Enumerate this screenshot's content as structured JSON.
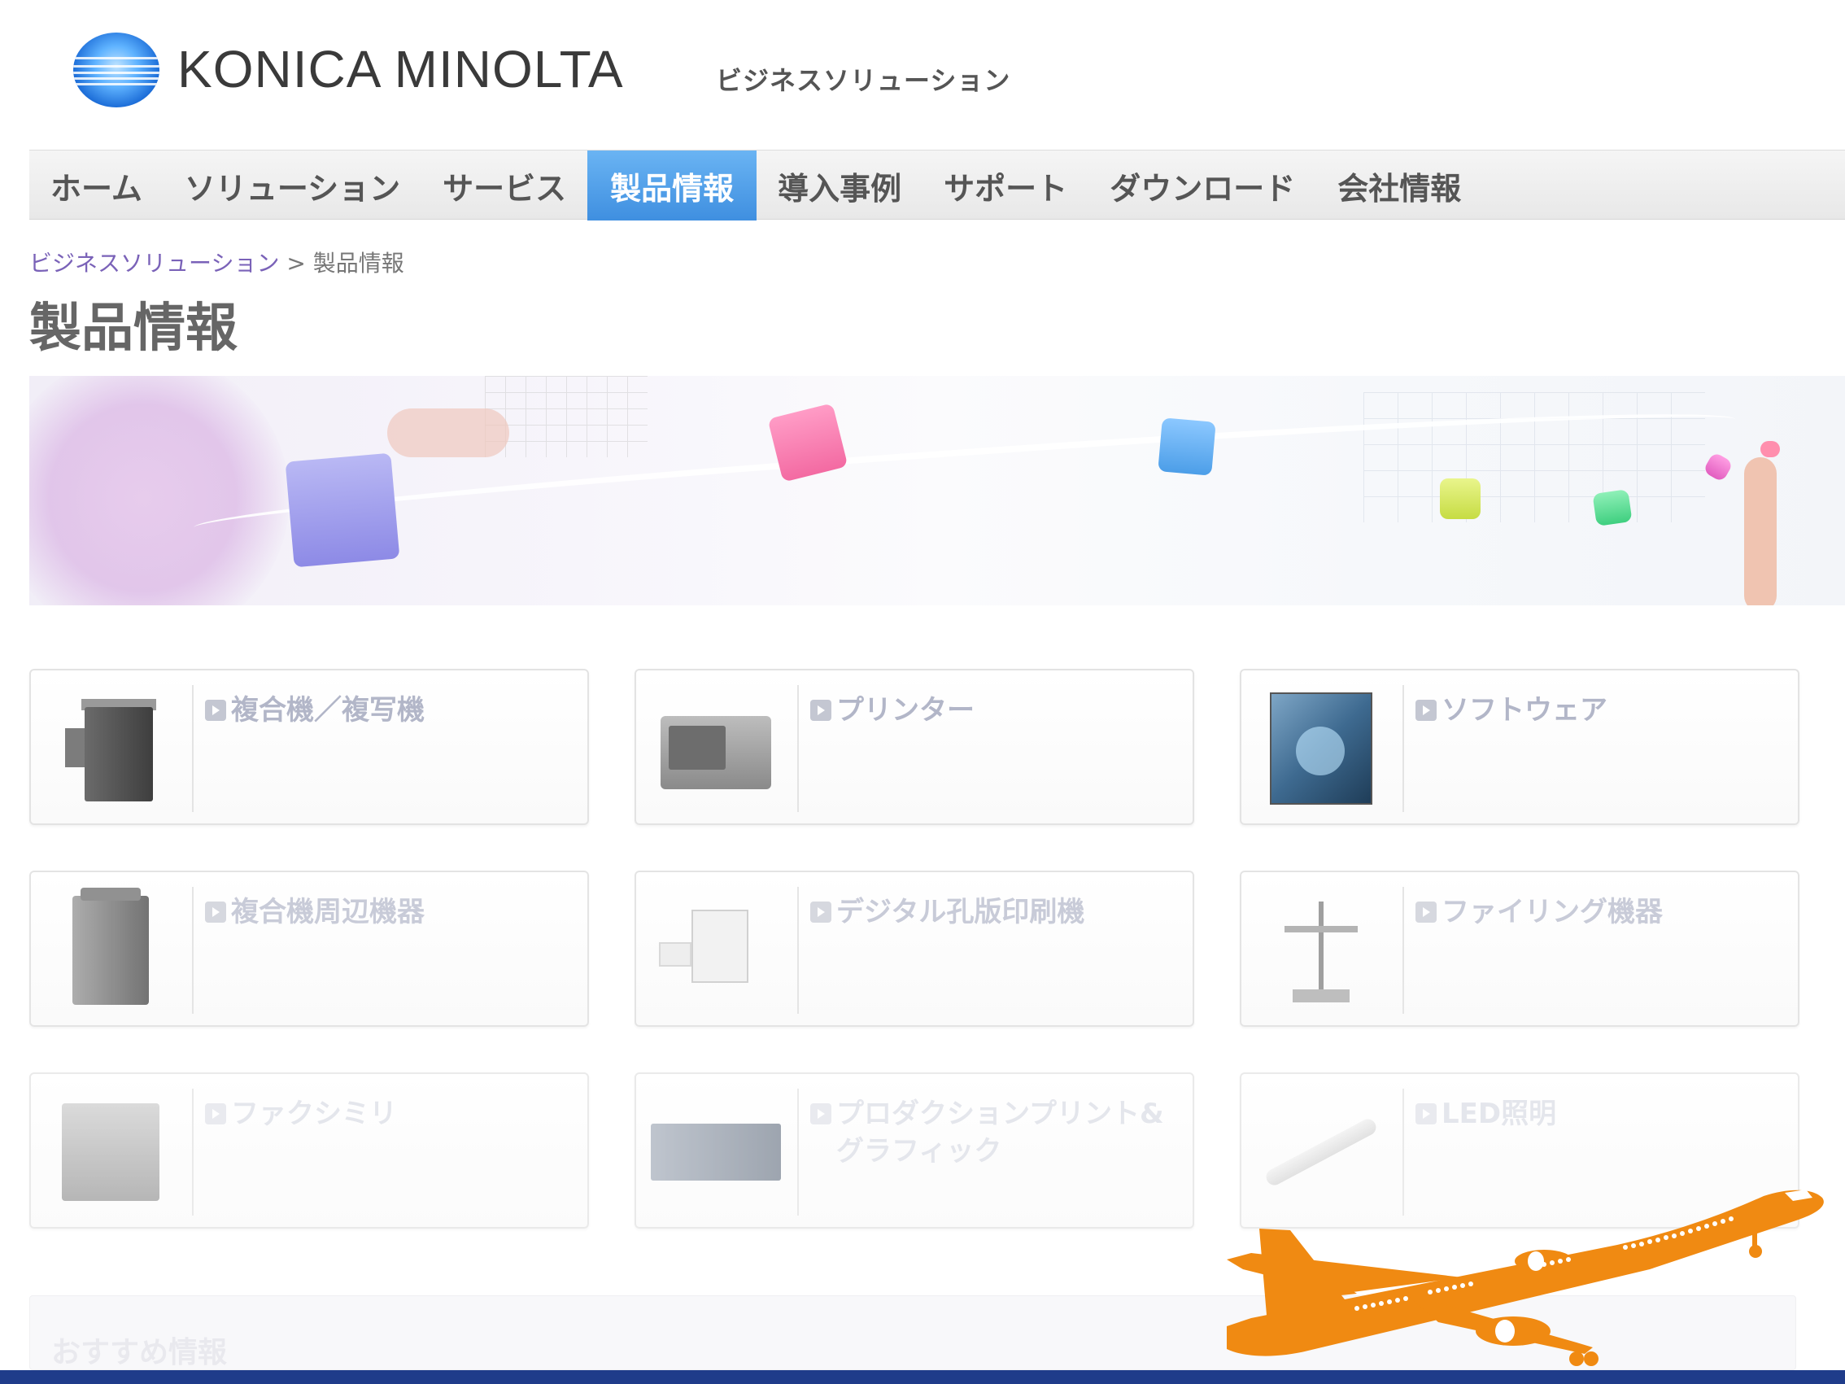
{
  "header": {
    "logo_text": "KONICA MINOLTA",
    "subtitle": "ビジネスソリューション",
    "logo_color": "#1e6fd9"
  },
  "nav": {
    "items": [
      {
        "label": "ホーム"
      },
      {
        "label": "ソリューション"
      },
      {
        "label": "サービス"
      },
      {
        "label": "製品情報",
        "active": true
      },
      {
        "label": "導入事例"
      },
      {
        "label": "サポート"
      },
      {
        "label": "ダウンロード"
      },
      {
        "label": "会社情報"
      }
    ],
    "active_color": "#4a98e6"
  },
  "breadcrumb": {
    "link": "ビジネスソリューション",
    "separator": " > ",
    "current": "製品情報"
  },
  "page_title": "製品情報",
  "products": [
    {
      "label": "複合機／複写機",
      "icon": "mfp-icon"
    },
    {
      "label": "プリンター",
      "icon": "printer-icon"
    },
    {
      "label": "ソフトウェア",
      "icon": "software-icon"
    },
    {
      "label": "複合機周辺機器",
      "icon": "peripheral-icon"
    },
    {
      "label": "デジタル孔版印刷機",
      "icon": "digital-duplicator-icon"
    },
    {
      "label": "ファイリング機器",
      "icon": "filing-icon"
    },
    {
      "label": "ファクシミリ",
      "icon": "fax-icon"
    },
    {
      "label": "プロダクションプリント&\nグラフィック",
      "icon": "production-print-icon"
    },
    {
      "label": "LED照明",
      "icon": "led-icon"
    }
  ],
  "recommended": {
    "title": "おすすめ情報"
  },
  "overlay": {
    "airplane_color": "#f08a12",
    "bottom_bar_color": "#1f3c8a"
  }
}
